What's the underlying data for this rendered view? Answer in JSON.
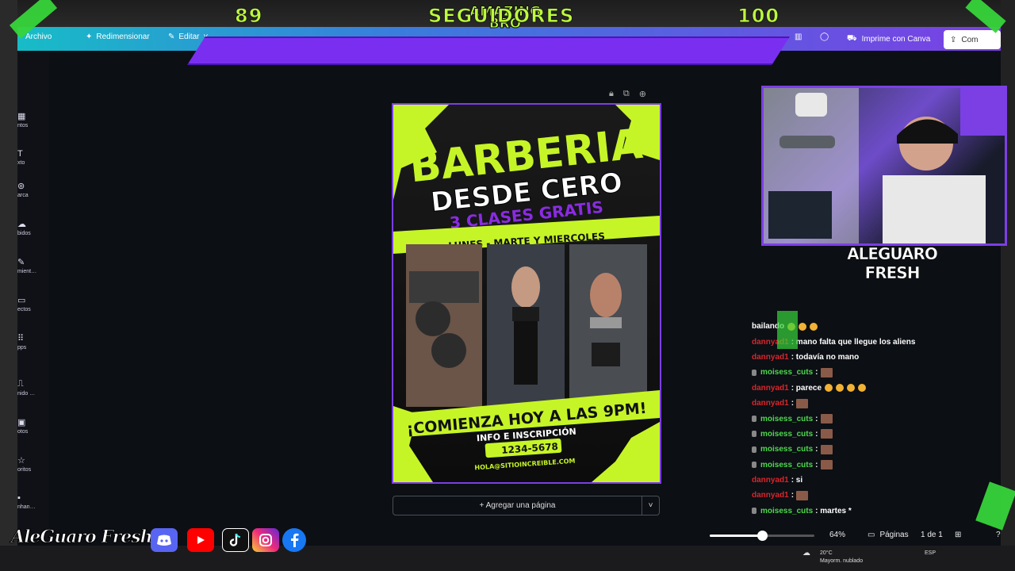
{
  "toolbar": {
    "archivo": "Archivo",
    "redimensionar": "Redimensionar",
    "editar": "Editar",
    "print": "Imprime con Canva",
    "share": "Com"
  },
  "followers": {
    "amazing": "AMAZING",
    "bro": "BRO",
    "current": "89",
    "label": "SEGUIDORES",
    "goal": "100",
    "progress": 0.89
  },
  "sidebar": {
    "items": [
      {
        "label": "ntos",
        "icon": "templates-icon"
      },
      {
        "label": "xto",
        "icon": "text-icon"
      },
      {
        "label": "arca",
        "icon": "brand-icon"
      },
      {
        "label": "bidos",
        "icon": "uploads-icon"
      },
      {
        "label": "mient…",
        "icon": "tools-icon"
      },
      {
        "label": "ectos",
        "icon": "projects-icon"
      },
      {
        "label": "pps",
        "icon": "apps-icon"
      },
      {
        "label": "nido …",
        "icon": "content-icon"
      },
      {
        "label": "otos",
        "icon": "photos-icon"
      },
      {
        "label": "oritos",
        "icon": "favorites-icon"
      },
      {
        "label": "nhan…",
        "icon": "enhance-icon"
      }
    ]
  },
  "poster": {
    "title1": "BARBERIA",
    "title2": "DESDE CERO",
    "sub": "3 CLASES GRATIS",
    "days": "LUNES - MARTE Y MIERCOLES",
    "cta": "¡COMIENZA HOY A LAS 9PM!",
    "info": "INFO E INSCRIPCIÓN",
    "phone": "1234-5678",
    "email": "HOLA@SITIOINCREIBLE.COM"
  },
  "add_page": "+ Agregar una página",
  "streamer_name": "ALEGUARO FRESH",
  "chat": [
    {
      "user": "",
      "color": "#ffffff",
      "msg": "bailando",
      "badge": false,
      "emote": false,
      "emoji": 3
    },
    {
      "user": "dannyad1",
      "color": "#d8262b",
      "msg": ": mano falta que llegue los aliens",
      "badge": false,
      "emote": false,
      "emoji": 0
    },
    {
      "user": "dannyad1",
      "color": "#d8262b",
      "msg": ": todavía no mano",
      "badge": false,
      "emote": false,
      "emoji": 0
    },
    {
      "user": "moisess_cuts",
      "color": "#4ed84e",
      "msg": ":",
      "badge": true,
      "emote": true,
      "emoji": 0
    },
    {
      "user": "dannyad1",
      "color": "#d8262b",
      "msg": ": parece",
      "badge": false,
      "emote": false,
      "emoji": 4
    },
    {
      "user": "dannyad1",
      "color": "#d8262b",
      "msg": ":",
      "badge": false,
      "emote": true,
      "emoji": 0
    },
    {
      "user": "moisess_cuts",
      "color": "#4ed84e",
      "msg": ":",
      "badge": true,
      "emote": true,
      "emoji": 0
    },
    {
      "user": "moisess_cuts",
      "color": "#4ed84e",
      "msg": ":",
      "badge": true,
      "emote": true,
      "emoji": 0
    },
    {
      "user": "moisess_cuts",
      "color": "#4ed84e",
      "msg": ":",
      "badge": true,
      "emote": true,
      "emoji": 0
    },
    {
      "user": "moisess_cuts",
      "color": "#4ed84e",
      "msg": ":",
      "badge": true,
      "emote": true,
      "emoji": 0
    },
    {
      "user": "dannyad1",
      "color": "#d8262b",
      "msg": ": si",
      "badge": false,
      "emote": false,
      "emoji": 0
    },
    {
      "user": "dannyad1",
      "color": "#d8262b",
      "msg": ":",
      "badge": false,
      "emote": true,
      "emoji": 0
    },
    {
      "user": "moisess_cuts",
      "color": "#4ed84e",
      "msg": ": martes *",
      "badge": true,
      "emote": false,
      "emoji": 0
    }
  ],
  "status": {
    "zoom": "64%",
    "zoom_level": 0.5,
    "pages_label": "Páginas",
    "page_count": "1 de 1"
  },
  "brand": {
    "name": "AleGuaro Fresh",
    "socials": [
      "discord-icon",
      "youtube-icon",
      "tiktok-icon",
      "instagram-icon",
      "facebook-icon"
    ]
  },
  "taskbar": {
    "temp": "20°C",
    "weather": "Mayorm. nublado",
    "lang": "ESP"
  },
  "colors": {
    "accent_green": "#bdfd3a",
    "accent_purple": "#7a2ff0",
    "chat_red": "#d8262b",
    "chat_green": "#4ed84e"
  }
}
